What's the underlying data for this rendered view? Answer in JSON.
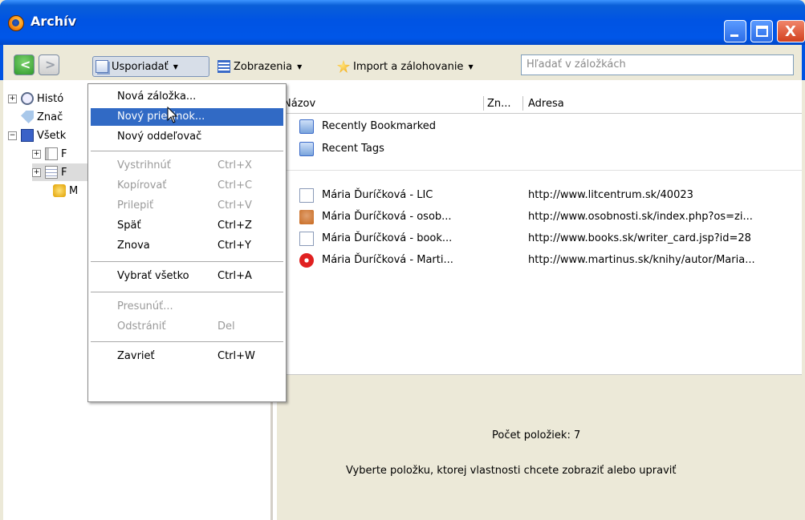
{
  "window": {
    "title": "Archív",
    "buttons": {
      "minimize": "_",
      "maximize": "□",
      "close": "X"
    }
  },
  "toolbar": {
    "back_label": "<",
    "forward_label": ">",
    "organize_label": "Usporiadať",
    "views_label": "Zobrazenia",
    "import_label": "Import a zálohovanie",
    "search_placeholder": "Hľadať v záložkách"
  },
  "tree": {
    "items": [
      {
        "label": "Histó",
        "icon": "clock-icon",
        "expander": "+"
      },
      {
        "label": "Znač",
        "icon": "tag-icon",
        "expander": ""
      },
      {
        "label": "Všetk",
        "icon": "star-icon",
        "expander": "−"
      },
      {
        "label": "F",
        "icon": "toolbar-icon",
        "expander": "+"
      },
      {
        "label": "F",
        "icon": "menu-icon",
        "expander": "+"
      },
      {
        "label": "M",
        "icon": "unsorted-icon",
        "expander": ""
      }
    ]
  },
  "list": {
    "columns": [
      "Názov",
      "Zn...",
      "Adresa"
    ],
    "rows": [
      {
        "name": "Recently Bookmarked",
        "url": "",
        "icon": "folder-icon"
      },
      {
        "name": "Recent Tags",
        "url": "",
        "icon": "folder-icon"
      },
      {
        "name": "Mária Ďuríčková - LIC",
        "url": "http://www.litcentrum.sk/40023",
        "icon": "page-icon"
      },
      {
        "name": "Mária Ďuríčková - osob...",
        "url": "http://www.osobnosti.sk/index.php?os=zi...",
        "icon": "person-icon"
      },
      {
        "name": "Mária Ďuríčková - book...",
        "url": "http://www.books.sk/writer_card.jsp?id=28",
        "icon": "page-icon"
      },
      {
        "name": "Mária Ďuríčková - Marti...",
        "url": "http://www.martinus.sk/knihy/autor/Maria...",
        "icon": "martinus-icon"
      }
    ]
  },
  "details": {
    "count_text": "Počet položiek: 7",
    "hint_text": "Vyberte položku, ktorej vlastnosti chcete zobraziť alebo upraviť"
  },
  "menu": {
    "items": [
      {
        "label": "Nová záložka...",
        "shortcut": "",
        "disabled": false
      },
      {
        "label": "Nový priečinok...",
        "shortcut": "",
        "disabled": false,
        "highlighted": true
      },
      {
        "label": "Nový oddeľovač",
        "shortcut": "",
        "disabled": false
      },
      {
        "label": "Vystrihnúť",
        "shortcut": "Ctrl+X",
        "disabled": true
      },
      {
        "label": "Kopírovať",
        "shortcut": "Ctrl+C",
        "disabled": true
      },
      {
        "label": "Prilepiť",
        "shortcut": "Ctrl+V",
        "disabled": true
      },
      {
        "label": "Späť",
        "shortcut": "Ctrl+Z",
        "disabled": false
      },
      {
        "label": "Znova",
        "shortcut": "Ctrl+Y",
        "disabled": false
      },
      {
        "label": "Vybrať všetko",
        "shortcut": "Ctrl+A",
        "disabled": false
      },
      {
        "label": "Presunúť...",
        "shortcut": "",
        "disabled": true
      },
      {
        "label": "Odstrániť",
        "shortcut": "Del",
        "disabled": true
      },
      {
        "label": "Zavrieť",
        "shortcut": "Ctrl+W",
        "disabled": false
      }
    ]
  },
  "colors": {
    "titlebar": "#0054e3",
    "menu_highlight": "#316ac5",
    "disabled_text": "#9a9a9a"
  }
}
